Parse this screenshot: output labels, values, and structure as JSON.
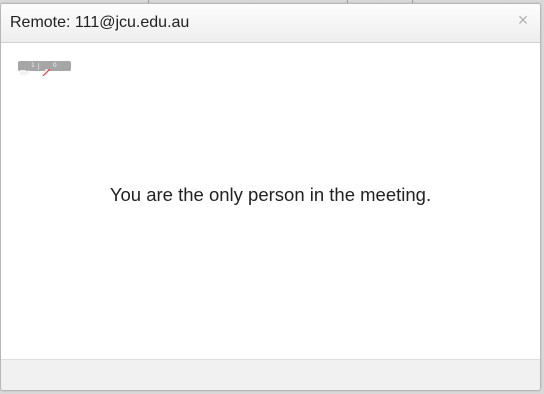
{
  "dialog": {
    "title": "Remote: 111@jcu.edu.au",
    "close_glyph": "×",
    "close_icon": "close-icon"
  },
  "media_stats": {
    "video_icon": "video-camera-icon",
    "video_count": "1",
    "audio_icon": "muted-microphone-icon",
    "audio_count": "0",
    "badge_color": "#a6a6a6",
    "muted_color": "#d9534f"
  },
  "main": {
    "message": "You are the only person in the meeting."
  }
}
